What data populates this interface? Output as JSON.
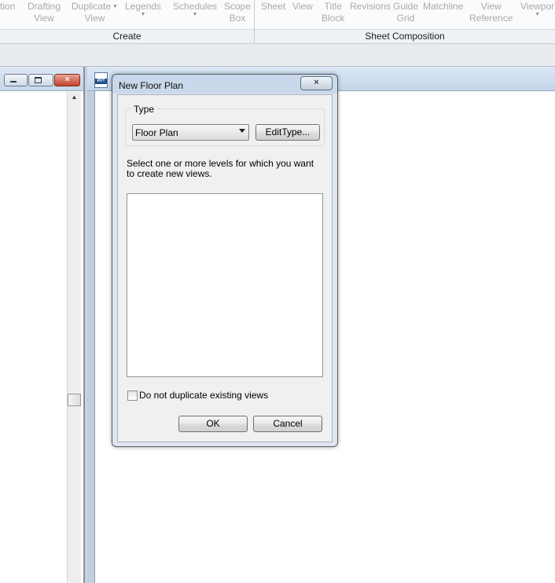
{
  "ribbon": {
    "buttons": [
      {
        "line1": "tion",
        "line2": ""
      },
      {
        "line1": "Drafting",
        "line2": "View"
      },
      {
        "line1": "Duplicate",
        "line2": "View"
      },
      {
        "line1": "Legends",
        "line2": ""
      },
      {
        "line1": "Schedules",
        "line2": ""
      },
      {
        "line1": "Scope",
        "line2": "Box"
      },
      {
        "line1": "Sheet",
        "line2": ""
      },
      {
        "line1": "View",
        "line2": ""
      },
      {
        "line1": "Title",
        "line2": "Block"
      },
      {
        "line1": "Revisions",
        "line2": ""
      },
      {
        "line1": "Guide",
        "line2": "Grid"
      },
      {
        "line1": "Matchline",
        "line2": ""
      },
      {
        "line1": "View",
        "line2": "Reference"
      },
      {
        "line1": "Viewpor",
        "line2": ""
      }
    ],
    "panels": {
      "create": "Create",
      "sheet_composition": "Sheet Composition"
    }
  },
  "left_panel": {
    "minimize_icon": "minimize-icon",
    "maximize_icon": "maximize-icon",
    "close_glyph": "×"
  },
  "document": {
    "icon_text": "RVT"
  },
  "dialog": {
    "title": "New Floor Plan",
    "close_glyph": "×",
    "type_group_label": "Type",
    "type_select_value": "Floor Plan",
    "edit_type_label": "EditType...",
    "instruction": "Select one or more levels for which you want to create new views.",
    "levels": [],
    "checkbox_label": "Do not duplicate existing views",
    "checkbox_checked": false,
    "ok_label": "OK",
    "cancel_label": "Cancel"
  }
}
